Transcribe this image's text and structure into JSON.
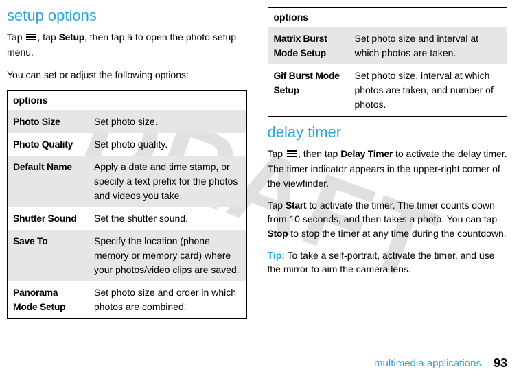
{
  "watermark": "DRAFT",
  "left": {
    "heading": "setup options",
    "intro_pre": "Tap ",
    "intro_mid": ", tap ",
    "setup_label": "Setup",
    "intro_post": ", then tap ã to open the photo setup menu.",
    "subtext": "You can set or adjust the following options:",
    "options_header": "options",
    "rows": [
      {
        "label": "Photo Size",
        "desc": "Set photo size."
      },
      {
        "label": "Photo Quality",
        "desc": "Set photo quality."
      },
      {
        "label": "Default Name",
        "desc": "Apply a date and time stamp, or specify a text prefix for the photos and videos you take."
      },
      {
        "label": "Shutter Sound",
        "desc": "Set the shutter sound."
      },
      {
        "label": "Save To",
        "desc": "Specify the location (phone memory or memory card) where your photos/video clips are saved."
      },
      {
        "label": "Panorama Mode Setup",
        "desc": "Set photo size and order in which photos are combined."
      }
    ]
  },
  "right": {
    "options_header": "options",
    "rows": [
      {
        "label": "Matrix Burst Mode Setup",
        "desc": "Set photo size and interval at which photos are taken."
      },
      {
        "label": "Gif Burst Mode Setup",
        "desc": "Set photo size, interval at which photos are taken, and number of photos."
      }
    ],
    "heading": "delay timer",
    "p1_pre": "Tap ",
    "p1_mid": ", then tap ",
    "delay_label": "Delay Timer",
    "p1_post": " to activate the delay timer. The timer indicator appears in the upper-right corner of the viewfinder.",
    "p2_pre": "Tap ",
    "start_label": "Start",
    "p2_mid": " to activate the timer. The timer counts down from 10 seconds, and then takes a photo. You can tap ",
    "stop_label": "Stop",
    "p2_post": " to stop the timer at any time during the countdown.",
    "tip_label": "Tip:",
    "tip_text": " To take a self-portrait, activate the timer, and use the mirror to aim the camera lens."
  },
  "footer": {
    "section": "multimedia applications",
    "page": "93"
  }
}
